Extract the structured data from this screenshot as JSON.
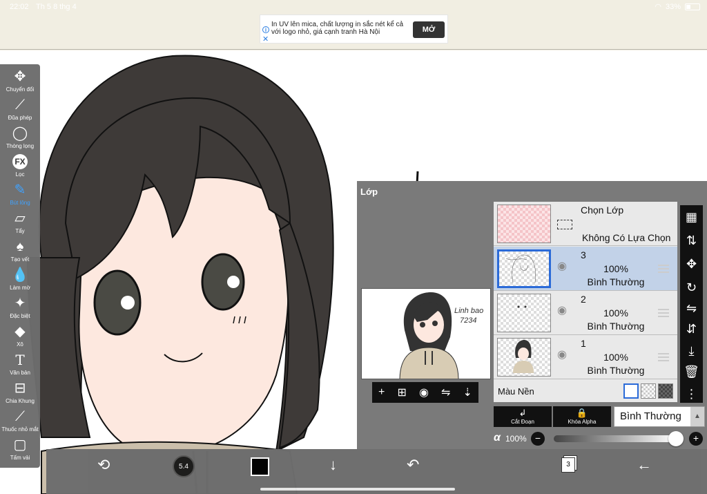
{
  "status_bar": {
    "time": "22:02",
    "date": "Th 5 8 thg 4",
    "battery": "33%"
  },
  "ad": {
    "text": "In UV lên mica, chất lượng in sắc nét kể cả với logo nhỏ, giá cạnh tranh Hà Nội",
    "button": "MỞ"
  },
  "toolbar": {
    "items": [
      {
        "label": "Chuyển đổi",
        "icon": "move-icon"
      },
      {
        "label": "Đũa phép",
        "icon": "magic-wand-icon"
      },
      {
        "label": "Thòng lọng",
        "icon": "lasso-icon"
      },
      {
        "label": "Lọc",
        "icon": "fx-icon"
      },
      {
        "label": "Bút lông",
        "icon": "brush-icon",
        "active": true
      },
      {
        "label": "Tẩy",
        "icon": "eraser-icon"
      },
      {
        "label": "Tạo vết",
        "icon": "smudge-icon"
      },
      {
        "label": "Làm mờ",
        "icon": "blur-icon"
      },
      {
        "label": "Đặc biệt",
        "icon": "special-icon"
      },
      {
        "label": "Xô",
        "icon": "bucket-icon"
      },
      {
        "label": "Văn bản",
        "icon": "text-icon"
      },
      {
        "label": "Chia Khung",
        "icon": "frame-divider-icon"
      },
      {
        "label": "Thuốc nhỏ mắt",
        "icon": "eyedropper-icon"
      },
      {
        "label": "Tấm vải",
        "icon": "canvas-icon"
      }
    ]
  },
  "bottom_bar": {
    "brush_size": "5.4",
    "color": "#000000",
    "layer_count": "3"
  },
  "layer_panel": {
    "title": "Lớp",
    "selection_layer": {
      "title": "Chọn Lớp",
      "subtitle": "Không Có Lựa Chọn"
    },
    "layers": [
      {
        "name": "3",
        "opacity": "100%",
        "mode": "Bình Thường",
        "selected": true
      },
      {
        "name": "2",
        "opacity": "100%",
        "mode": "Bình Thường",
        "selected": false
      },
      {
        "name": "1",
        "opacity": "100%",
        "mode": "Bình Thường",
        "selected": false
      }
    ],
    "background_label": "Màu Nền",
    "clip_label": "Cắt Đoạn",
    "alpha_lock_label": "Khóa Alpha",
    "blend_mode": "Bình Thường",
    "alpha_symbol": "α",
    "alpha_value": "100%",
    "preview_signature_line1": "Linh bao",
    "preview_signature_line2": "7234"
  },
  "colors": {
    "accent": "#2a6ad8",
    "panel": "#7a7a7a",
    "toolbar": "#6d6d6d",
    "active_tool": "#3aa0ff"
  }
}
